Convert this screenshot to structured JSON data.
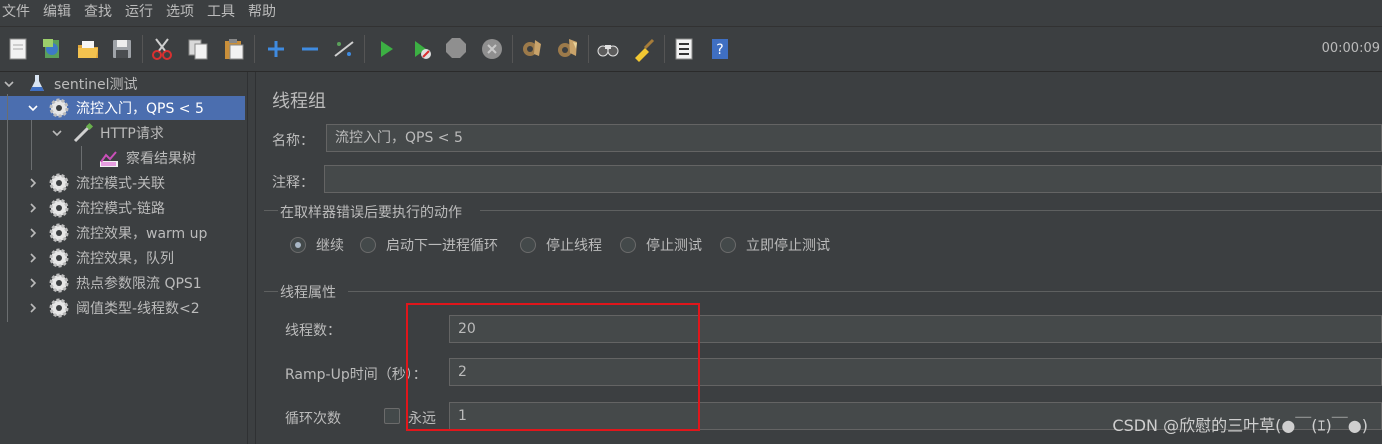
{
  "menu": [
    "文件",
    "编辑",
    "查找",
    "运行",
    "选项",
    "工具",
    "帮助"
  ],
  "toolbar": {
    "timer": "00:00:09",
    "icons": [
      "new-icon",
      "templates-icon",
      "open-icon",
      "save-icon",
      "cut-icon",
      "copy-icon",
      "paste-icon",
      "expand-icon",
      "collapse-icon",
      "toggle-icon",
      "start-icon",
      "start-no-pause-icon",
      "stop-icon",
      "shutdown-icon",
      "clear-icon",
      "clear-all-icon",
      "search-icon",
      "reset-search-icon",
      "function-helper-icon",
      "help-icon"
    ]
  },
  "tree": {
    "root": "sentinel测试",
    "items": [
      {
        "label": "流控入门，QPS < 5",
        "selected": true,
        "expanded": true
      },
      {
        "label": "HTTP请求",
        "expanded": true
      },
      {
        "label": "察看结果树"
      },
      {
        "label": "流控模式-关联"
      },
      {
        "label": "流控模式-链路"
      },
      {
        "label": "流控效果，warm up"
      },
      {
        "label": "流控效果，队列"
      },
      {
        "label": "热点参数限流 QPS1"
      },
      {
        "label": "阈值类型-线程数<2"
      }
    ]
  },
  "form": {
    "title": "线程组",
    "name_label": "名称：",
    "name_value": "流控入门，QPS < 5",
    "comment_label": "注释：",
    "comment_value": "",
    "sampler_error_title": "在取样器错误后要执行的动作",
    "actions": [
      {
        "label": "继续",
        "checked": true
      },
      {
        "label": "启动下一进程循环",
        "checked": false
      },
      {
        "label": "停止线程",
        "checked": false
      },
      {
        "label": "停止测试",
        "checked": false
      },
      {
        "label": "立即停止测试",
        "checked": false
      }
    ],
    "thread_props_title": "线程属性",
    "threads_label": "线程数：",
    "threads_value": "20",
    "rampup_label": "Ramp-Up时间（秒）：",
    "rampup_value": "2",
    "loop_label": "循环次数",
    "forever_label": "永远",
    "forever_checked": false,
    "loop_value": "1"
  },
  "watermark": "CSDN @欣慰的三叶草(●￣(ｴ)￣●)",
  "colors": {
    "accent": "#4b6eaf",
    "highlight_box": "#e0161b",
    "background": "#3c3f41",
    "field": "#45494a"
  }
}
